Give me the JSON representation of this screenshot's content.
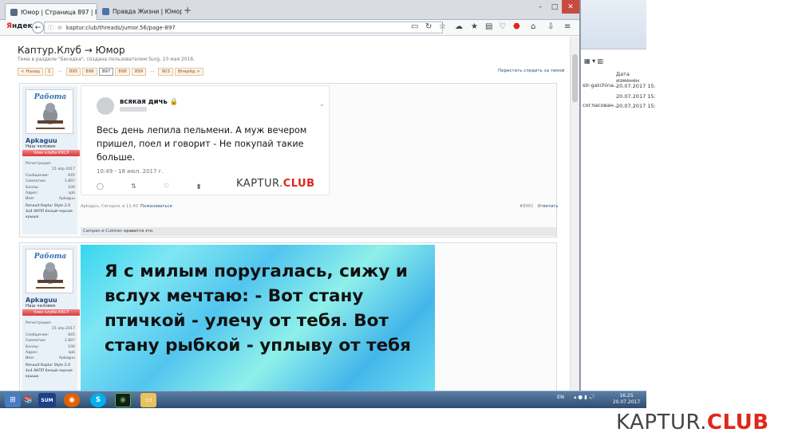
{
  "browser": {
    "tabs": [
      {
        "label": "Юмор | Страница 897 | Рен",
        "active": true
      },
      {
        "label": "Правда Жизни | Юмор, Мо",
        "active": false
      }
    ],
    "new_tab": "+",
    "yandex": {
      "first": "Я",
      "rest": "ндекс"
    },
    "url": "kaptur.club/threads/jumor.56/page-897"
  },
  "page": {
    "title": "Каптур.Клуб → Юмор",
    "subtitle": "Тема в разделе \"Беседка\", создана пользователем Surg, 23 мая 2016.",
    "pager": [
      "< Назад",
      "1",
      "...",
      "895",
      "896",
      "897",
      "898",
      "899",
      "...",
      "903",
      "Вперёд >"
    ],
    "pager_current": "897",
    "watch_link": "Перестать следить за темой"
  },
  "user": {
    "name": "Apkaguu",
    "title": "Наш человек",
    "badge": "Член клуба ККСР",
    "avatar_caption": "Работа",
    "stats": [
      {
        "label": "Регистрация:",
        "value": ""
      },
      {
        "label": "",
        "value": "15 апр 2017"
      },
      {
        "label": "Сообщения:",
        "value": "645"
      },
      {
        "label": "Симпатии:",
        "value": "1.807"
      },
      {
        "label": "Баллы:",
        "value": "100"
      },
      {
        "label": "Адрес:",
        "value": "spb"
      },
      {
        "label": "Имя:",
        "value": "Apkaguu"
      }
    ],
    "car": "Renault Kaptur Style 2.0 4x4 АКПП белый-черная крыша"
  },
  "post1": {
    "tweet": {
      "name": "всякая дичь",
      "text": "Весь день лепила пельмени. А муж вечером пришел, поел и говорит - Не покупай такие больше.",
      "time": "10:49 - 18 июл. 2017 г."
    },
    "watermark": {
      "part1": "KAPTUR.",
      "part2": "CLUB"
    },
    "meta": "Apkaguu, Сегодня, в 11:40",
    "report": "Пожаловаться",
    "number": "#8961",
    "reply": "Ответить",
    "likes_users": "Campan и Cubinec",
    "likes_rest": " нравится это."
  },
  "post2": {
    "image_text": "Я с милым поругалась, сижу и вслух мечтаю: - Вот стану птичкой - улечу от тебя. Вот стану рыбкой - уплыву от тебя"
  },
  "background_window": {
    "items": [
      "str-gatchina...",
      "согласован..."
    ],
    "column": "Дата изменен",
    "dates": [
      "20.07.2017 15:",
      "20.07.2017 15:",
      "20.07.2017 15:"
    ]
  },
  "taskbar": {
    "sum_label": "SUM",
    "lang": "EN",
    "time": "16:25",
    "date": "20.07.2017"
  },
  "watermark_big": {
    "part1": "KAPTUR.",
    "part2": "CLUB"
  }
}
